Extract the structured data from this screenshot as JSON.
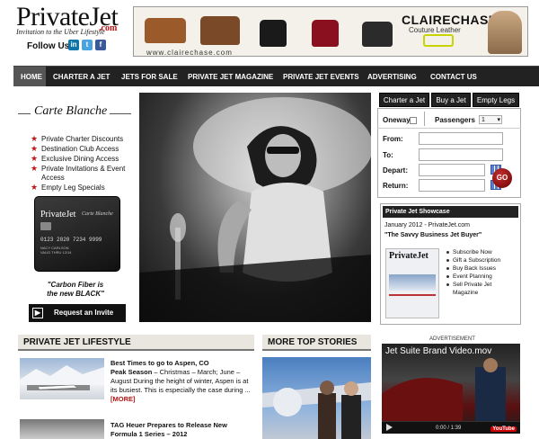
{
  "header": {
    "logo": "PrivateJet",
    "logo_suffix": ".com",
    "tagline": "Invitation to the Uber Lifestyle",
    "follow_label": "Follow Us",
    "social": [
      {
        "name": "linkedin",
        "glyph": "in",
        "color": "#0e76a8"
      },
      {
        "name": "twitter",
        "glyph": "t",
        "color": "#4aa3df"
      },
      {
        "name": "facebook",
        "glyph": "f",
        "color": "#3b5998"
      }
    ]
  },
  "ad_banner": {
    "url": "www.clairechase.com",
    "brand": "CLAIRECHASE",
    "subtitle": "Couture Leather"
  },
  "nav": {
    "items": [
      "HOME",
      "CHARTER A JET",
      "JETS FOR SALE",
      "PRIVATE JET MAGAZINE",
      "PRIVATE JET EVENTS",
      "ADVERTISING",
      "CONTACT US"
    ],
    "active_index": 0
  },
  "carte_blanche": {
    "title": "Carte Blanche",
    "perks": [
      "Private Charter Discounts",
      "Destination Club Access",
      "Exclusive Dining Access",
      "Private Invitations & Event Access",
      "Empty Leg Specials"
    ],
    "card": {
      "brand": "PrivateJet",
      "script": "Carte Blanche",
      "number": "0123 2020 7234 9999",
      "holder_lines": [
        "NACY CARLSON",
        "VALID THRU 12/14"
      ]
    },
    "slogan_line1": "\"Carbon Fiber is",
    "slogan_line2": "the new BLACK\"",
    "button": "Request an Invite"
  },
  "booking": {
    "tabs": [
      "Charter a Jet",
      "Buy a Jet",
      "Empty Legs"
    ],
    "oneway_label": "Oneway",
    "passengers_label": "Passengers",
    "passengers_value": "1",
    "from_label": "From:",
    "to_label": "To:",
    "depart_label": "Depart:",
    "return_label": "Return:",
    "go_label": "GO"
  },
  "showcase": {
    "title": "Private Jet Showcase",
    "date": "January 2012 - PrivateJet.com",
    "headline": "\"The Savvy Business Jet Buyer\"",
    "magazine_brand": "PrivateJet",
    "links": [
      "Subscribe Now",
      "Gift a Subscription",
      "Buy Back Issues",
      "Event Planning",
      "Sell Private Jet Magazine"
    ]
  },
  "lifestyle": {
    "title": "PRIVATE JET LIFESTYLE",
    "story1_title_line1": "Best Times to go to Aspen, CO",
    "story1_title_line2": "Peak Season",
    "story1_text": " – Christmas – March; June – August During the height of winter, Aspen is at its busiest. This is especially the case during ...",
    "story1_more": "[MORE]",
    "story2_title_line1": "TAG Heuer Prepares to Release New",
    "story2_title_line2": "Formula 1 Series – 2012"
  },
  "top_stories": {
    "title": "MORE TOP STORIES"
  },
  "video": {
    "label": "ADVERTISEMENT",
    "title": "Jet Suite Brand Video.mov",
    "time": "0:00 / 1:39",
    "platform": "YouTube"
  }
}
